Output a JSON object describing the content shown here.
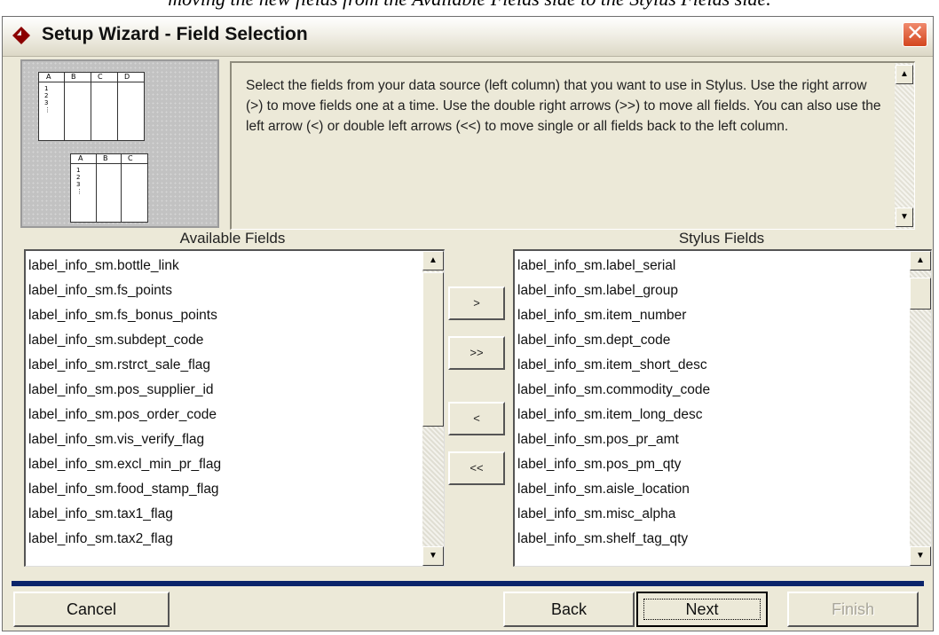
{
  "caption": "moving the new fields from the Available Fields side to the Stylus Fields side.",
  "window": {
    "title": "Setup Wizard - Field Selection",
    "close_symbol": "✕"
  },
  "preview": {
    "top_header": [
      "A",
      "B",
      "C",
      "D"
    ],
    "bottom_header": [
      "A",
      "B",
      "C"
    ],
    "row_marks": [
      "1",
      "2",
      "3",
      "⋮"
    ]
  },
  "instructions": "Select the fields from your data source (left column) that you want to use in Stylus. Use the right arrow (>) to move fields one at a time. Use the double right arrows (>>) to move all fields. You can also use the left arrow (<) or double left arrows (<<) to move single or all fields back to the left column.",
  "available": {
    "label": "Available Fields",
    "items": [
      "label_info_sm.bottle_link",
      "label_info_sm.fs_points",
      "label_info_sm.fs_bonus_points",
      "label_info_sm.subdept_code",
      "label_info_sm.rstrct_sale_flag",
      "label_info_sm.pos_supplier_id",
      "label_info_sm.pos_order_code",
      "label_info_sm.vis_verify_flag",
      "label_info_sm.excl_min_pr_flag",
      "label_info_sm.food_stamp_flag",
      "label_info_sm.tax1_flag",
      "label_info_sm.tax2_flag"
    ]
  },
  "stylus": {
    "label": "Stylus Fields",
    "items": [
      "label_info_sm.label_serial",
      "label_info_sm.label_group",
      "label_info_sm.item_number",
      "label_info_sm.dept_code",
      "label_info_sm.item_short_desc",
      "label_info_sm.commodity_code",
      "label_info_sm.item_long_desc",
      "label_info_sm.pos_pr_amt",
      "label_info_sm.pos_pm_qty",
      "label_info_sm.aisle_location",
      "label_info_sm.misc_alpha",
      "label_info_sm.shelf_tag_qty"
    ]
  },
  "move_buttons": {
    "add_one": ">",
    "add_all": ">>",
    "remove_one": "<",
    "remove_all": "<<"
  },
  "scroll_arrows": {
    "up": "▲",
    "down": "▼"
  },
  "footer": {
    "cancel": "Cancel",
    "back": "Back",
    "next": "Next",
    "finish": "Finish"
  },
  "colors": {
    "divider": "#0a246a",
    "window_bg": "#ece9d8",
    "close_button": "#d3461f",
    "app_icon": "#8b0000"
  },
  "icons": {
    "app": "red-diamond-arrow-icon",
    "close": "close-icon"
  }
}
